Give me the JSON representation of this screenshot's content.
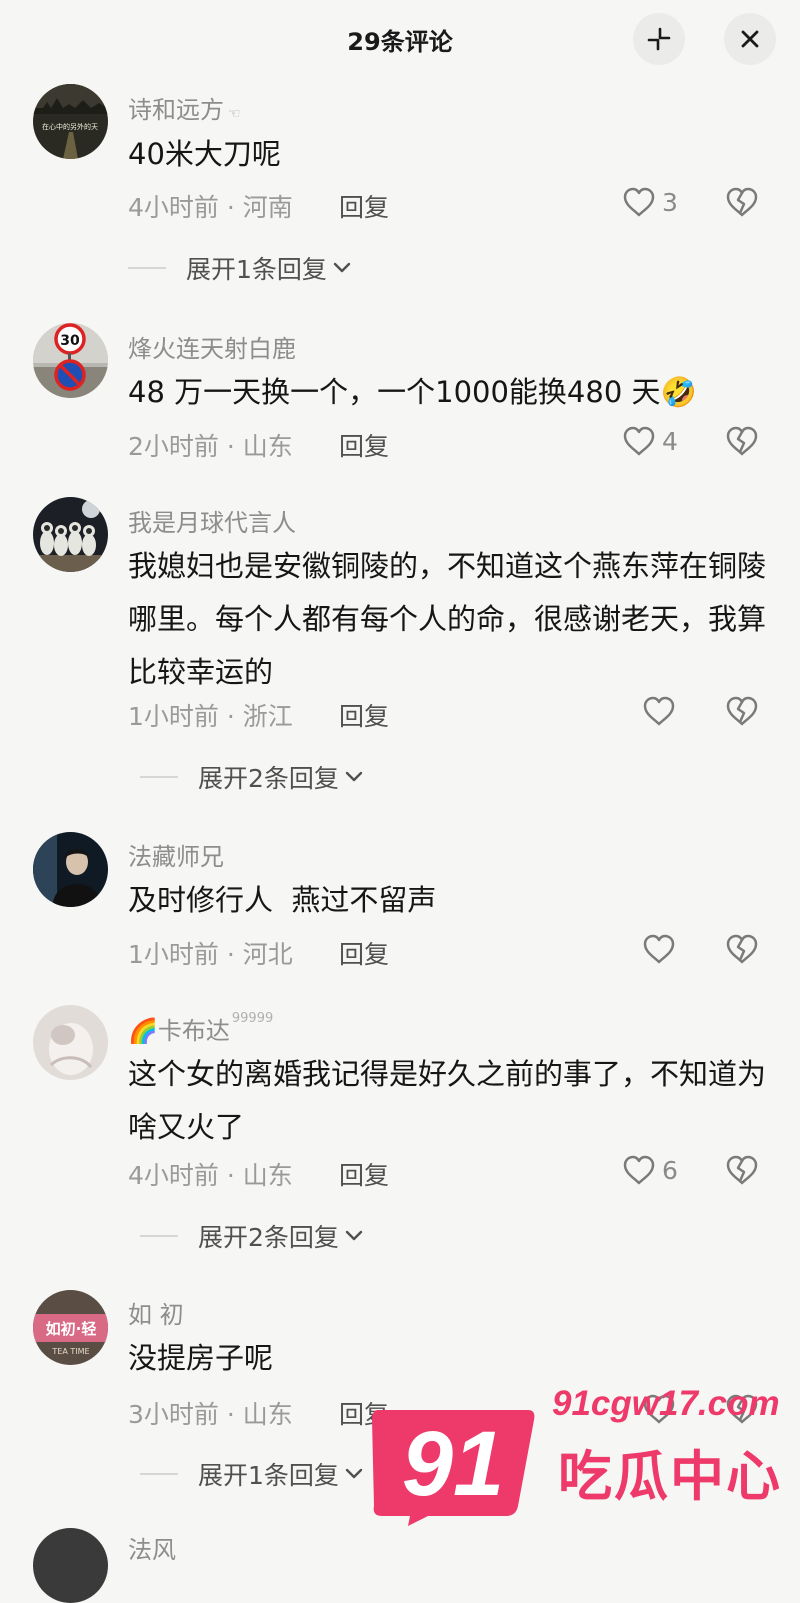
{
  "header": {
    "title": "29条评论"
  },
  "comments": [
    {
      "user": "诗和远方",
      "user_tag": "☜",
      "text": "40米大刀呢",
      "time": "4小时前",
      "location": "河南",
      "reply": "回复",
      "likes": "3",
      "expand": "展开1条回复"
    },
    {
      "user": "烽火连天射白鹿",
      "text": "48 万一天换一个，一个1000能换480 天🤣",
      "time": "2小时前",
      "location": "山东",
      "reply": "回复",
      "likes": "4"
    },
    {
      "user": "我是月球代言人",
      "text": "我媳妇也是安徽铜陵的，不知道这个燕东萍在铜陵哪里。每个人都有每个人的命，很感谢老天，我算比较幸运的",
      "time": "1小时前",
      "location": "浙江",
      "reply": "回复",
      "likes": "",
      "expand": "展开2条回复"
    },
    {
      "user": "法藏师兄",
      "text": "及时修行人  燕过不留声",
      "time": "1小时前",
      "location": "河北",
      "reply": "回复",
      "likes": ""
    },
    {
      "user_prefix": "🌈",
      "user": "卡布达",
      "user_tag": "99999",
      "text": "这个女的离婚我记得是好久之前的事了，不知道为啥又火了",
      "time": "4小时前",
      "location": "山东",
      "reply": "回复",
      "likes": "6",
      "expand": "展开2条回复"
    },
    {
      "user": "如 初",
      "text": "没提房子呢",
      "time": "3小时前",
      "location": "山东",
      "reply": "回复",
      "likes": "",
      "expand": "展开1条回复"
    },
    {
      "user": "法风",
      "text": "",
      "time": "",
      "location": "",
      "reply": "",
      "likes": ""
    }
  ],
  "avatars": {
    "a0_text": "在心中的另外的天",
    "a1_sign": "30",
    "a5_text1": "如初·轻",
    "a5_text2": "TEA TIME"
  },
  "separator": " · ",
  "watermark": {
    "logo_text": "91",
    "site": "91cgw17.com",
    "name": "吃瓜中心"
  },
  "colors": {
    "background": "#f6f6f4",
    "accent_pink": "#ee3a6a",
    "text_primary": "#161616",
    "text_secondary": "#8d8d8d"
  },
  "icons": {
    "collapse": "collapse-icon",
    "close": "close-icon",
    "like": "heart-outline-icon",
    "dislike": "broken-heart-icon",
    "expand": "chevron-down-icon"
  }
}
